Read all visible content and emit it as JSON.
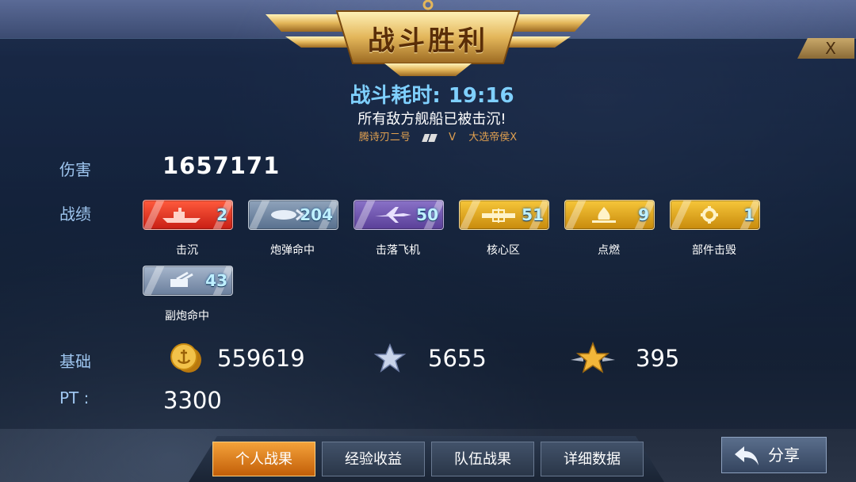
{
  "header": {
    "title": "战斗胜利",
    "close_label": "X"
  },
  "battle": {
    "duration_label": "战斗耗时:",
    "duration_value": "19:16",
    "result_message": "所有敌方舰船已被击沉!",
    "player_left": "腾诗刃二号",
    "vs_text": "V",
    "player_right": "大选帝侯X"
  },
  "damage": {
    "label": "伤害",
    "value": "1657171"
  },
  "records": {
    "label": "战绩",
    "items": [
      {
        "name": "击沉",
        "count": "2",
        "icon": "battleship-icon",
        "color": "#e0301e"
      },
      {
        "name": "炮弹命中",
        "count": "204",
        "icon": "shell-icon",
        "color": "#6f86a4"
      },
      {
        "name": "击落飞机",
        "count": "50",
        "icon": "aircraft-icon",
        "color": "#6e55b0"
      },
      {
        "name": "核心区",
        "count": "51",
        "icon": "citadel-icon",
        "color": "#e0a620"
      },
      {
        "name": "点燃",
        "count": "9",
        "icon": "fire-icon",
        "color": "#e0a620"
      },
      {
        "name": "部件击毁",
        "count": "1",
        "icon": "gear-icon",
        "color": "#e0a620"
      },
      {
        "name": "副炮命中",
        "count": "43",
        "icon": "secondary-gun-icon",
        "color": "#8a9ab4"
      }
    ]
  },
  "base": {
    "label": "基础",
    "coins": "559619",
    "silver_star": "5655",
    "gold_star": "395"
  },
  "pt": {
    "label": "PT :",
    "value": "3300"
  },
  "tabs": [
    {
      "label": "个人战果",
      "active": true
    },
    {
      "label": "经验收益",
      "active": false
    },
    {
      "label": "队伍战果",
      "active": false
    },
    {
      "label": "详细数据",
      "active": false
    }
  ],
  "share": {
    "label": "分享"
  }
}
